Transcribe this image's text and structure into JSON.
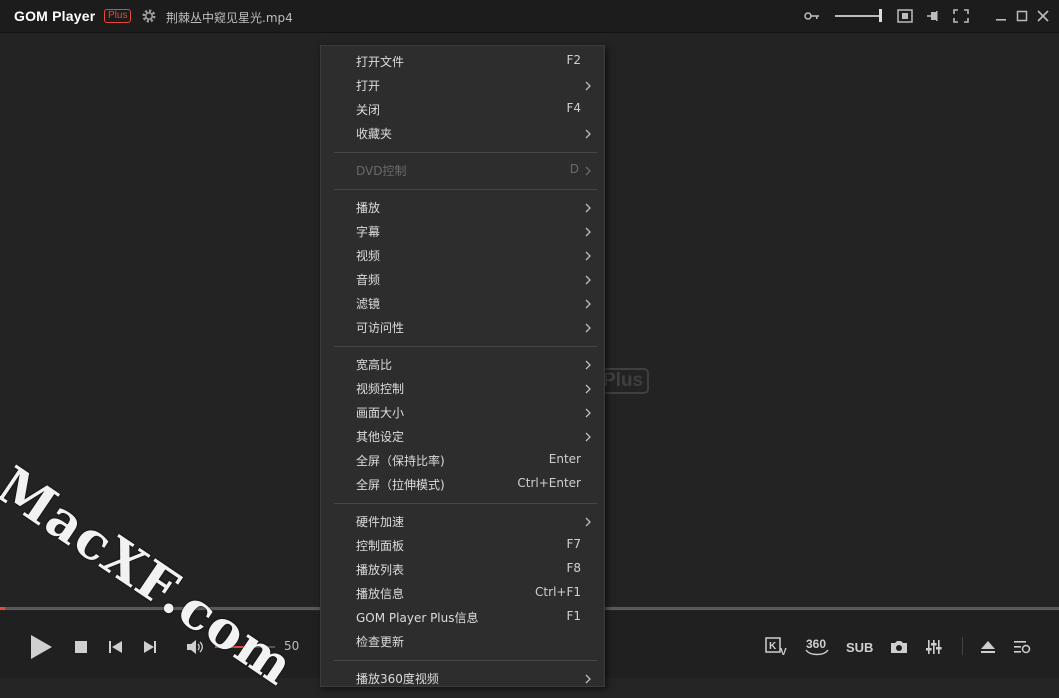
{
  "titlebar": {
    "app_name": "GOM Player",
    "badge": "Plus",
    "filename": "荆棘丛中窥见星光.mp4",
    "icons": [
      "settings-gear-icon",
      "key-icon",
      "volume-slider",
      "window-size-icon",
      "pin-icon",
      "fullscreen-icon",
      "minimize-icon",
      "maximize-icon",
      "close-icon"
    ]
  },
  "video": {
    "background_logo_text": "Plus"
  },
  "watermark": "MacXF.com",
  "progress": {
    "played_fraction": 0.005,
    "accent": "#e2493b"
  },
  "controls": {
    "volume_value": "50",
    "volume_fraction": 0.5,
    "sub_label": "SUB",
    "vr_label": "360",
    "icons": [
      "play-icon",
      "stop-icon",
      "prev-icon",
      "next-icon",
      "speaker-icon",
      "kv-icon",
      "360-icon",
      "sub-icon",
      "camera-icon",
      "equalizer-icon",
      "eject-icon",
      "playlist-icon"
    ]
  },
  "menu": {
    "items": [
      {
        "label": "打开文件",
        "shortcut": "F2",
        "submenu": false,
        "disabled": false
      },
      {
        "label": "打开",
        "shortcut": "",
        "submenu": true,
        "disabled": false
      },
      {
        "label": "关闭",
        "shortcut": "F4",
        "submenu": false,
        "disabled": false
      },
      {
        "label": "收藏夹",
        "shortcut": "",
        "submenu": true,
        "disabled": false
      },
      {
        "label": "DVD控制",
        "shortcut": "D",
        "submenu": true,
        "disabled": true
      },
      {
        "label": "播放",
        "shortcut": "",
        "submenu": true,
        "disabled": false
      },
      {
        "label": "字幕",
        "shortcut": "",
        "submenu": true,
        "disabled": false
      },
      {
        "label": "视频",
        "shortcut": "",
        "submenu": true,
        "disabled": false
      },
      {
        "label": "音频",
        "shortcut": "",
        "submenu": true,
        "disabled": false
      },
      {
        "label": "滤镜",
        "shortcut": "",
        "submenu": true,
        "disabled": false
      },
      {
        "label": "可访问性",
        "shortcut": "",
        "submenu": true,
        "disabled": false
      },
      {
        "label": "宽高比",
        "shortcut": "",
        "submenu": true,
        "disabled": false
      },
      {
        "label": "视频控制",
        "shortcut": "",
        "submenu": true,
        "disabled": false
      },
      {
        "label": "画面大小",
        "shortcut": "",
        "submenu": true,
        "disabled": false
      },
      {
        "label": "其他设定",
        "shortcut": "",
        "submenu": true,
        "disabled": false
      },
      {
        "label": "全屏（保持比率)",
        "shortcut": "Enter",
        "submenu": false,
        "disabled": false
      },
      {
        "label": "全屏（拉伸模式)",
        "shortcut": "Ctrl+Enter",
        "submenu": false,
        "disabled": false
      },
      {
        "label": "硬件加速",
        "shortcut": "",
        "submenu": true,
        "disabled": false
      },
      {
        "label": "控制面板",
        "shortcut": "F7",
        "submenu": false,
        "disabled": false
      },
      {
        "label": "播放列表",
        "shortcut": "F8",
        "submenu": false,
        "disabled": false
      },
      {
        "label": "播放信息",
        "shortcut": "Ctrl+F1",
        "submenu": false,
        "disabled": false
      },
      {
        "label": "GOM Player Plus信息",
        "shortcut": "F1",
        "submenu": false,
        "disabled": false
      },
      {
        "label": "检查更新",
        "shortcut": "",
        "submenu": false,
        "disabled": false
      },
      {
        "label": "播放360度视频",
        "shortcut": "",
        "submenu": true,
        "disabled": false
      }
    ]
  }
}
